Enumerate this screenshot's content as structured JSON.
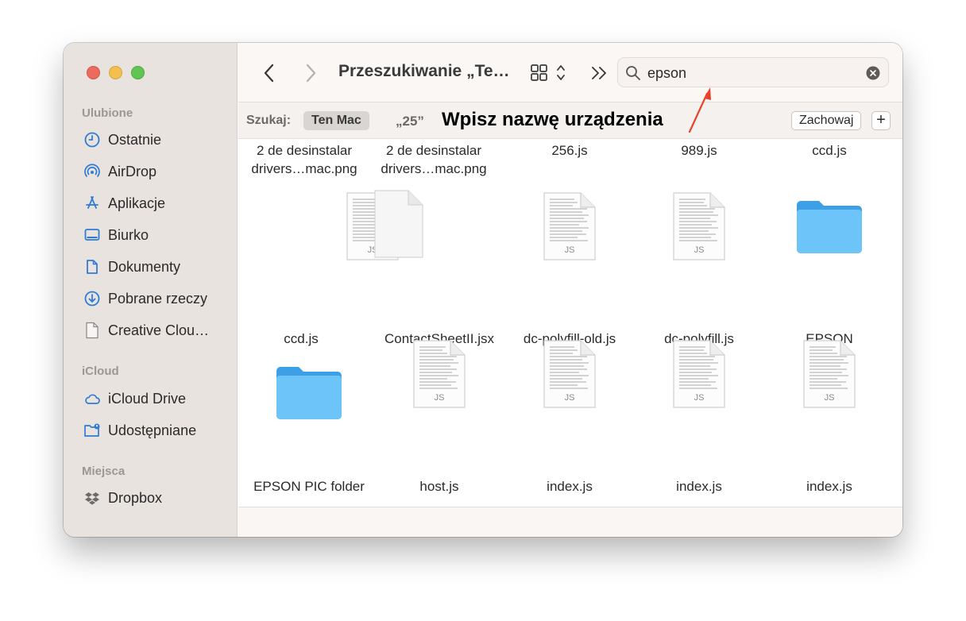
{
  "sidebar": {
    "favorites_title": "Ulubione",
    "favorites": [
      {
        "label": "Ostatnie",
        "icon": "clock-icon"
      },
      {
        "label": "AirDrop",
        "icon": "airdrop-icon"
      },
      {
        "label": "Aplikacje",
        "icon": "applications-icon"
      },
      {
        "label": "Biurko",
        "icon": "desktop-icon"
      },
      {
        "label": "Dokumenty",
        "icon": "document-icon"
      },
      {
        "label": "Pobrane rzeczy",
        "icon": "download-icon"
      },
      {
        "label": "Creative Clou…",
        "icon": "file-icon"
      }
    ],
    "icloud_title": "iCloud",
    "icloud": [
      {
        "label": "iCloud Drive",
        "icon": "cloud-icon"
      },
      {
        "label": "Udostępniane",
        "icon": "shared-folder-icon"
      }
    ],
    "places_title": "Miejsca",
    "places": [
      {
        "label": "Dropbox",
        "icon": "dropbox-icon"
      }
    ]
  },
  "toolbar": {
    "title": "Przeszukiwanie „Te…",
    "search_value": "epson"
  },
  "scopebar": {
    "label": "Szukaj:",
    "active_scope": "Ten Mac",
    "alt_scope": "„25”",
    "annotation": "Wpisz nazwę urządzenia",
    "save_label": "Zachowaj",
    "add_label": "+"
  },
  "files": {
    "row0": [
      "2 de desinstalar\ndrivers…mac.png",
      "2 de desinstalar\ndrivers…mac.png",
      "256.js",
      "989.js",
      "ccd.js"
    ],
    "row1": [
      {
        "name": "ccd.js",
        "kind": "js",
        "badge": "JS"
      },
      {
        "name": "ContactSheetII.jsx",
        "kind": "blank",
        "badge": ""
      },
      {
        "name": "dc-polyfill-old.js",
        "kind": "js",
        "badge": "JS"
      },
      {
        "name": "dc-polyfill.js",
        "kind": "js",
        "badge": "JS"
      },
      {
        "name": "EPSON",
        "kind": "folder",
        "badge": ""
      }
    ],
    "row2": [
      {
        "name": "EPSON PIC folder",
        "kind": "folder",
        "badge": ""
      },
      {
        "name": "host.js",
        "kind": "js",
        "badge": "JS"
      },
      {
        "name": "index.js",
        "kind": "js",
        "badge": "JS"
      },
      {
        "name": "index.js",
        "kind": "js",
        "badge": "JS"
      },
      {
        "name": "index.js",
        "kind": "js",
        "badge": "JS"
      }
    ]
  },
  "colors": {
    "accent": "#2f7bd6",
    "folder": "#5ab8f5",
    "annotation_arrow": "#e8412c"
  }
}
